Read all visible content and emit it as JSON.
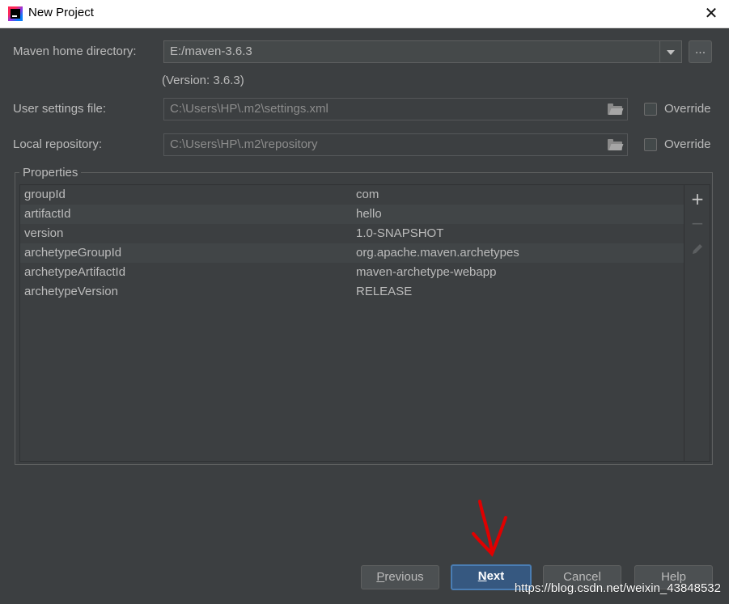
{
  "window": {
    "title": "New Project"
  },
  "form": {
    "maven_home": {
      "label": "Maven home directory:",
      "value": "E:/maven-3.6.3",
      "browse_label": "...",
      "version_note": "(Version: 3.6.3)"
    },
    "user_settings": {
      "label": "User settings file:",
      "value": "C:\\Users\\HP\\.m2\\settings.xml",
      "override_label": "Override",
      "override_checked": false
    },
    "local_repo": {
      "label": "Local repository:",
      "value": "C:\\Users\\HP\\.m2\\repository",
      "override_label": "Override",
      "override_checked": false
    }
  },
  "properties": {
    "title": "Properties",
    "rows": [
      {
        "key": "groupId",
        "value": "com"
      },
      {
        "key": "artifactId",
        "value": "hello"
      },
      {
        "key": "version",
        "value": "1.0-SNAPSHOT"
      },
      {
        "key": "archetypeGroupId",
        "value": "org.apache.maven.archetypes"
      },
      {
        "key": "archetypeArtifactId",
        "value": "maven-archetype-webapp"
      },
      {
        "key": "archetypeVersion",
        "value": "RELEASE"
      }
    ]
  },
  "buttons": {
    "previous": {
      "mn": "P",
      "rest": "revious"
    },
    "next": {
      "mn": "N",
      "rest": "ext"
    },
    "cancel": "Cancel",
    "help": "Help"
  },
  "watermark": "https://blog.csdn.net/weixin_43848532",
  "colors": {
    "background": "#3c3f41",
    "accent": "#365880",
    "annotation": "#e00000"
  },
  "icons": {
    "app": "intellij-icon",
    "close": "close-icon",
    "dropdown": "chevron-down-icon",
    "folder": "folder-icon",
    "add": "plus-icon",
    "remove": "minus-icon",
    "edit": "pencil-icon"
  }
}
